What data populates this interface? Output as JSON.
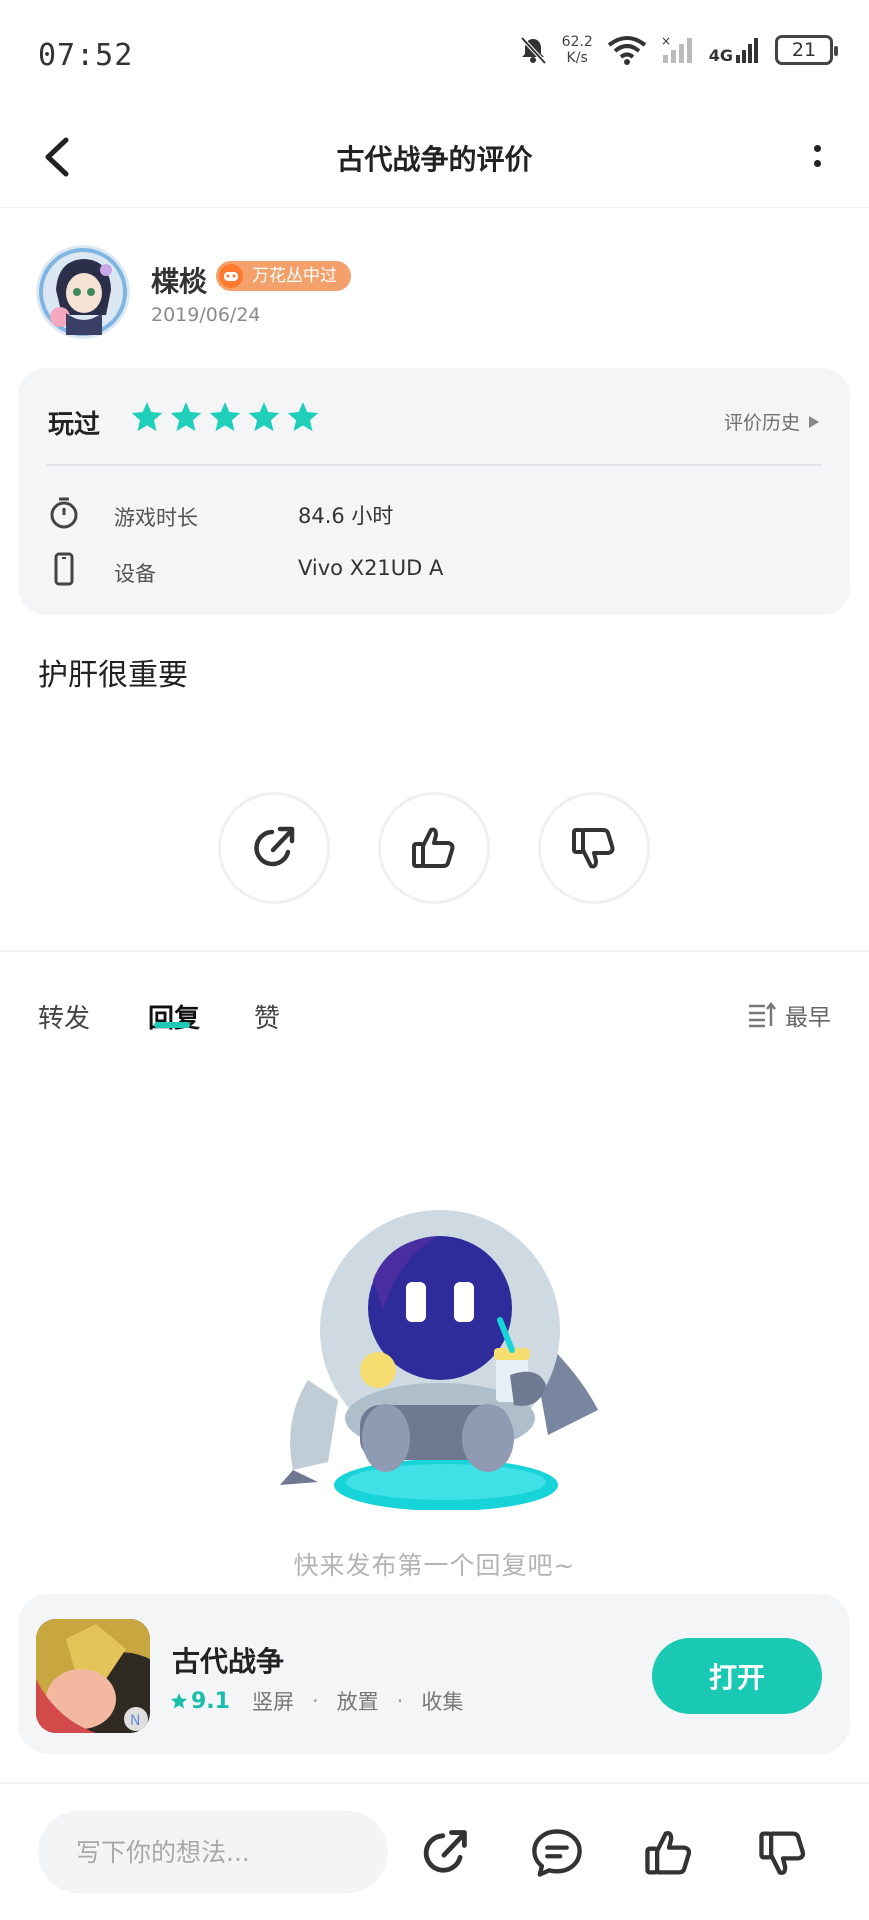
{
  "status_bar": {
    "time": "07:52",
    "net_speed_value": "62.2",
    "net_speed_unit": "K/s",
    "network": "4G",
    "battery": "21"
  },
  "header": {
    "title": "古代战争的评价"
  },
  "user": {
    "name": "楪棪",
    "badge": "万花丛中过",
    "date": "2019/06/24"
  },
  "info_card": {
    "played_label": "玩过",
    "rating_stars": 5,
    "history_label": "评价历史",
    "play_time_label": "游戏时长",
    "play_time_value": "84.6 小时",
    "device_label": "设备",
    "device_value": "Vivo X21UD A"
  },
  "review": {
    "text": "护肝很重要"
  },
  "tabs": {
    "repost": "转发",
    "reply": "回复",
    "like": "赞",
    "sort_label": "最早"
  },
  "empty_state": {
    "text": "快来发布第一个回复吧~"
  },
  "app_card": {
    "name": "古代战争",
    "rating": "9.1",
    "tags": [
      "竖屏",
      "放置",
      "收集"
    ],
    "open_label": "打开"
  },
  "bottom_bar": {
    "input_placeholder": "写下你的想法..."
  },
  "colors": {
    "accent": "#19c9b4",
    "star": "#1fcfb9",
    "badge": "#f3a06a"
  }
}
